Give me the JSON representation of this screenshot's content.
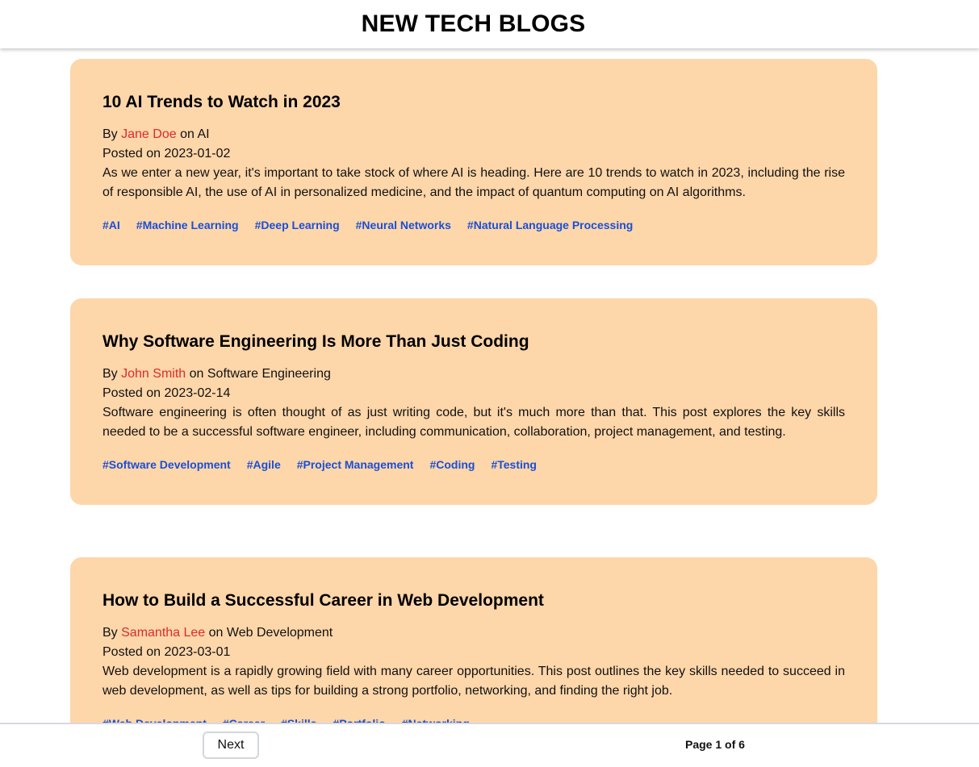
{
  "header": {
    "title": "NEW TECH BLOGS"
  },
  "posts": [
    {
      "title": "10 AI Trends to Watch in 2023",
      "by_label": "By",
      "author": "Jane Doe",
      "on_label": "on",
      "category": "AI",
      "posted_label": "Posted on",
      "date": "2023-01-02",
      "excerpt": "As we enter a new year, it's important to take stock of where AI is heading. Here are 10 trends to watch in 2023, including the rise of responsible AI, the use of AI in personalized medicine, and the impact of quantum computing on AI algorithms.",
      "tags": [
        "#AI",
        "#Machine Learning",
        "#Deep Learning",
        "#Neural Networks",
        "#Natural Language Processing"
      ]
    },
    {
      "title": "Why Software Engineering Is More Than Just Coding",
      "by_label": "By",
      "author": "John Smith",
      "on_label": "on",
      "category": "Software Engineering",
      "posted_label": "Posted on",
      "date": "2023-02-14",
      "excerpt": "Software engineering is often thought of as just writing code, but it's much more than that. This post explores the key skills needed to be a successful software engineer, including communication, collaboration, project management, and testing.",
      "tags": [
        "#Software Development",
        "#Agile",
        "#Project Management",
        "#Coding",
        "#Testing"
      ]
    },
    {
      "title": "How to Build a Successful Career in Web Development",
      "by_label": "By",
      "author": "Samantha Lee",
      "on_label": "on",
      "category": "Web Development",
      "posted_label": "Posted on",
      "date": "2023-03-01",
      "excerpt": "Web development is a rapidly growing field with many career opportunities. This post outlines the key skills needed to succeed in web development, as well as tips for building a strong portfolio, networking, and finding the right job.",
      "tags": [
        "#Web Development",
        "#Career",
        "#Skills",
        "#Portfolio",
        "#Networking"
      ]
    }
  ],
  "pagination": {
    "next_label": "Next",
    "page_text": "Page 1 of 6"
  },
  "colors": {
    "card_background": "#fdd6aa",
    "author_link": "#d92c2c",
    "tag_link": "#1a4fd6"
  }
}
